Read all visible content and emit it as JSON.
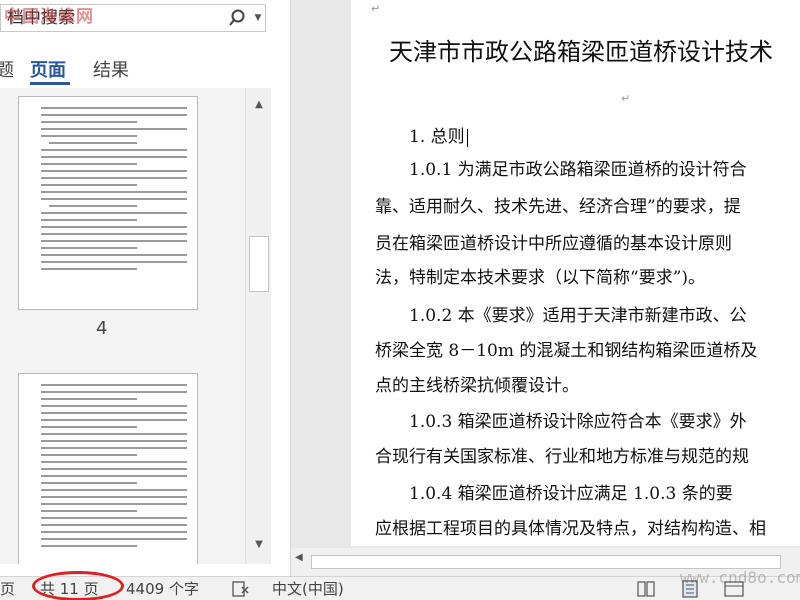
{
  "navigation": {
    "search_text": "档中搜索",
    "tab_partial": "题",
    "tabs": [
      {
        "label": "页面",
        "active": true
      },
      {
        "label": "结果",
        "active": false
      }
    ],
    "page_number_label": "4"
  },
  "document": {
    "title": "天津市市政公路箱梁匝道桥设计技术",
    "lines": [
      "1. 总则",
      "1.0.1 为满足市政公路箱梁匝道桥的设计符合",
      "靠、适用耐久、技术先进、经济合理”的要求，提",
      "员在箱梁匝道桥设计中所应遵循的基本设计原则",
      "法，特制定本技术要求（以下简称“要求”)。",
      "1.0.2 本《要求》适用于天津市新建市政、公",
      "桥梁全宽 8－10m 的混凝土和钢结构箱梁匝道桥及",
      "点的主线桥梁抗倾覆设计。",
      "1.0.3 箱梁匝道桥设计除应符合本《要求》外",
      "合现行有关国家标准、行业和地方标准与规范的规",
      "1.0.4 箱梁匝道桥设计应满足 1.0.3 条的要",
      "应根据工程项目的具体情况及特点，对结构构造、相"
    ]
  },
  "status_bar": {
    "page_partial": "页",
    "page_count": "共 11 页",
    "word_count": "4409 个字",
    "language": "中文(中国)"
  },
  "watermarks": {
    "top": "中国海峰网",
    "bottom": "www.cnd8o.com"
  },
  "colors": {
    "accent": "#2b579a",
    "highlight_circle": "#e0201e"
  },
  "icons": {
    "search": "search-icon",
    "dropdown": "chevron-down-icon",
    "proofing": "proofing-icon",
    "read_mode": "read-mode-icon",
    "print_layout": "print-layout-icon",
    "web_layout": "web-layout-icon"
  }
}
